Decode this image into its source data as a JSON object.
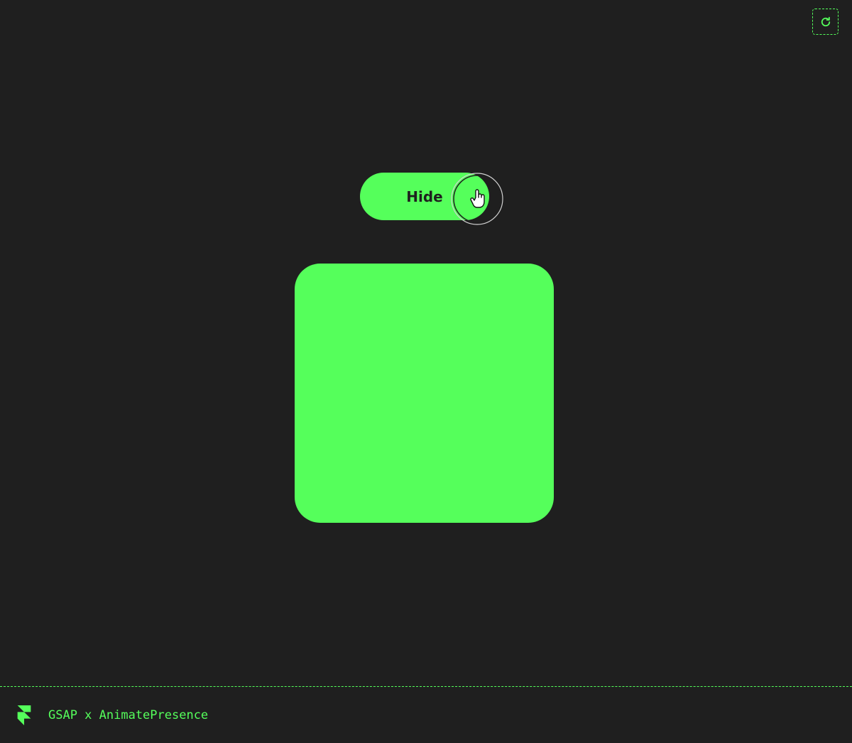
{
  "toggle": {
    "label": "Hide"
  },
  "footer": {
    "title": "GSAP x AnimatePresence"
  },
  "icons": {
    "refresh": "refresh-icon",
    "logo": "framer-logo-icon",
    "cursor": "hand-pointer-icon"
  },
  "colors": {
    "accent": "#55ff5b",
    "background": "#1f1f1f"
  }
}
